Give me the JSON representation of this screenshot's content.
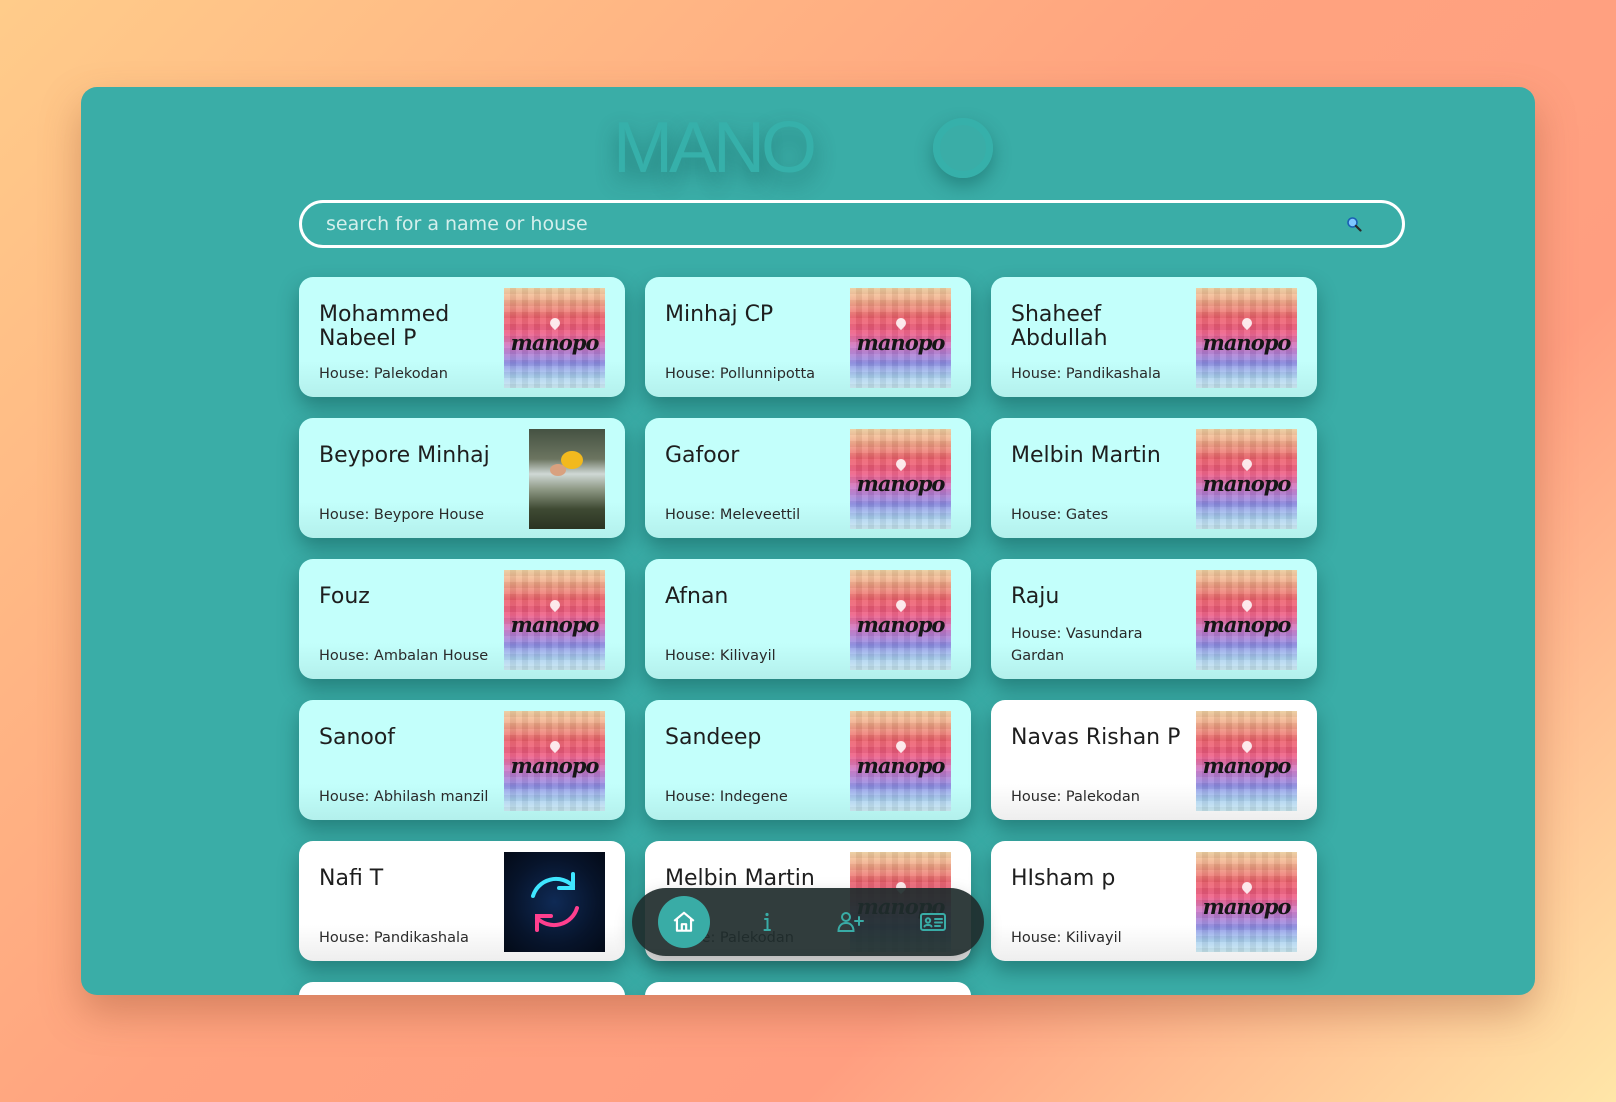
{
  "brand": {
    "logo_text": "MANO"
  },
  "search": {
    "placeholder": "search for a name or house"
  },
  "house_prefix": "House: ",
  "members": [
    {
      "name": "Mohammed Nabeel P",
      "house": "House: Palekodan",
      "image": "manopo-logo",
      "style": "cyan"
    },
    {
      "name": "Minhaj CP",
      "house": "House: Pollunnipotta",
      "image": "manopo-logo",
      "style": "cyan"
    },
    {
      "name": "Shaheef Abdullah",
      "house": "House: Pandikashala",
      "image": "manopo-logo",
      "style": "cyan"
    },
    {
      "name": "Beypore Minhaj",
      "house": "House: Beypore House",
      "image": "waterfall-photo",
      "style": "cyan"
    },
    {
      "name": "Gafoor",
      "house": "House: Meleveettil",
      "image": "manopo-logo",
      "style": "cyan"
    },
    {
      "name": "Melbin Martin",
      "house": "House: Gates",
      "image": "manopo-logo",
      "style": "cyan"
    },
    {
      "name": "Fouz",
      "house": "House: Ambalan House",
      "image": "manopo-logo",
      "style": "cyan"
    },
    {
      "name": "Afnan",
      "house": "House: Kilivayil",
      "image": "manopo-logo",
      "style": "cyan"
    },
    {
      "name": "Raju",
      "house": "House: Vasundara Gardan",
      "image": "manopo-logo",
      "style": "cyan"
    },
    {
      "name": "Sanoof",
      "house": "House: Abhilash manzil",
      "image": "manopo-logo",
      "style": "cyan"
    },
    {
      "name": "Sandeep",
      "house": "House: Indegene",
      "image": "manopo-logo",
      "style": "cyan"
    },
    {
      "name": "Navas Rishan P",
      "house": "House: Palekodan",
      "image": "manopo-logo",
      "style": "white"
    },
    {
      "name": "Nafi T",
      "house": "House: Pandikashala",
      "image": "neon-sync-icon",
      "style": "white"
    },
    {
      "name": "Melbin Martin",
      "house": "House: Palekodan",
      "image": "manopo-logo",
      "style": "white"
    },
    {
      "name": "HIsham p",
      "house": "House: Kilivayil",
      "image": "manopo-logo",
      "style": "white"
    },
    {
      "name": "",
      "house": "",
      "image": "",
      "style": "white"
    },
    {
      "name": "",
      "house": "",
      "image": "",
      "style": "white"
    }
  ],
  "image_text": {
    "manopo": "manopo"
  },
  "nav": [
    {
      "icon": "home-icon",
      "active": true
    },
    {
      "icon": "info-icon",
      "active": false
    },
    {
      "icon": "add-user-icon",
      "active": false
    },
    {
      "icon": "contact-card-icon",
      "active": false
    }
  ],
  "colors": {
    "panel": "#3aada7",
    "card_cyan": "#c3fffb",
    "card_white": "#ffffff",
    "nav_bg": "#1f2d2d",
    "nav_active": "#39aca6"
  }
}
